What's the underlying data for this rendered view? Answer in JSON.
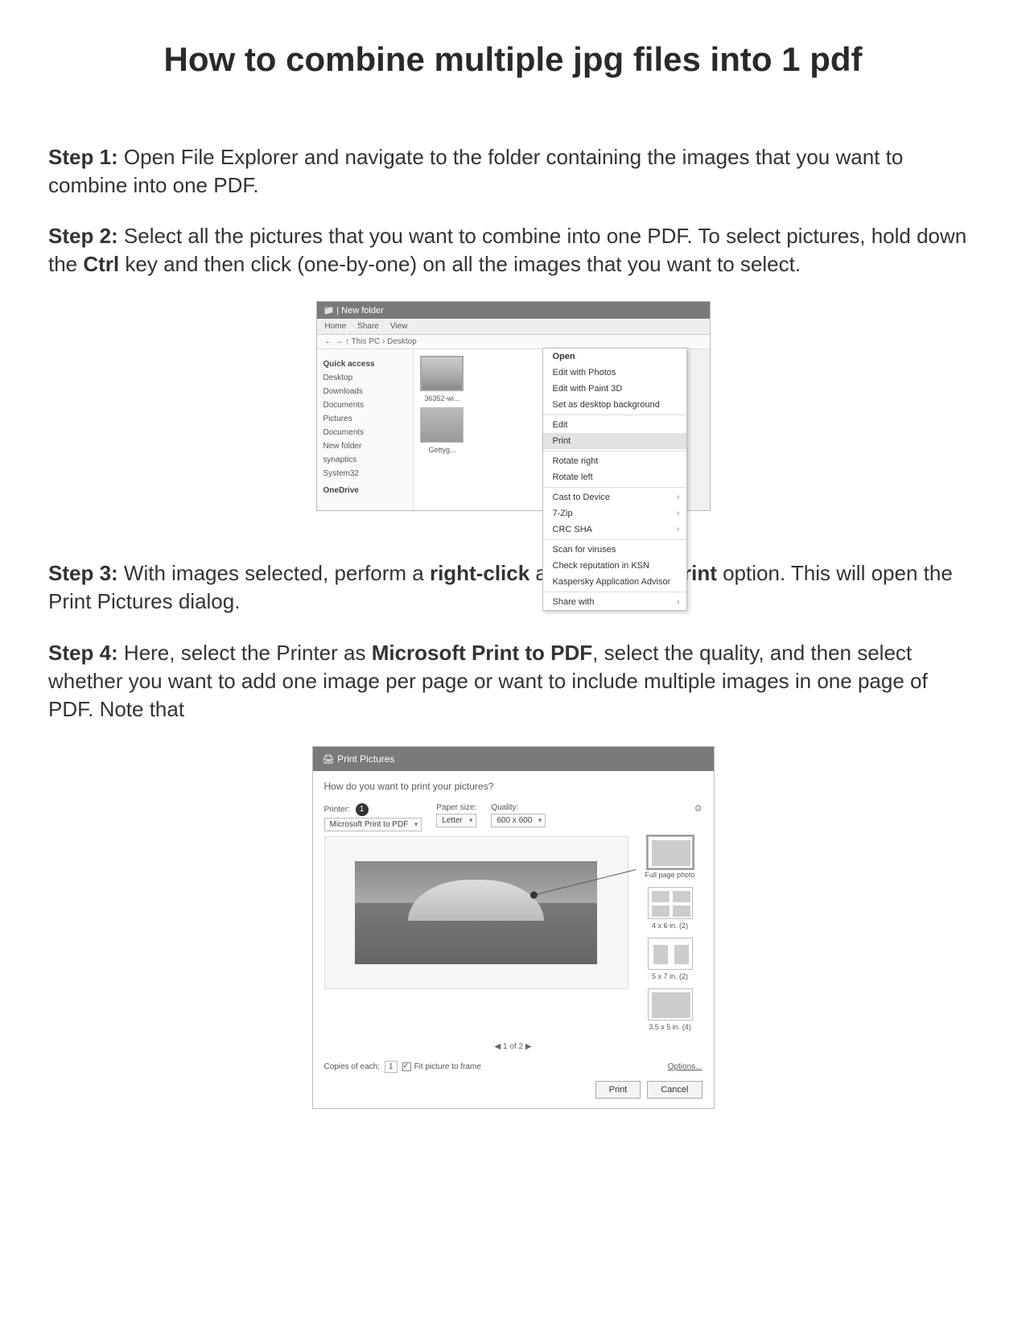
{
  "title": "How to combine multiple jpg files into 1 pdf",
  "steps": {
    "s1": {
      "label": "Step 1:",
      "text": " Open File Explorer and navigate to the folder containing the images that you want to combine into one PDF."
    },
    "s2": {
      "label": "Step 2:",
      "text_a": " Select all the pictures that you want to combine into one PDF. To select pictures, hold down the ",
      "ctrl": "Ctrl",
      "text_b": " key and then click (one-by-one) on all the images that you want to select."
    },
    "s3": {
      "label": "Step 3:",
      "text_a": " With images selected, perform a ",
      "rc": "right-click",
      "text_b": " and then click ",
      "print": "Print",
      "text_c": " option. This will open the Print Pictures dialog."
    },
    "s4": {
      "label": "Step 4:",
      "text_a": " Here, select the Printer as ",
      "mp": "Microsoft Print to PDF",
      "text_b": ", select the quality, and then select whether you want to add one image per page or want to include multiple images in one page of PDF. Note that"
    }
  },
  "explorer": {
    "window_title": "New folder",
    "tabs": [
      "Home",
      "Share",
      "View"
    ],
    "address": "This PC › Desktop",
    "sidebar": {
      "quick": "Quick access",
      "items": [
        "Desktop",
        "Downloads",
        "Documents",
        "Pictures",
        "Documents",
        "New folder",
        "synaptics",
        "System32"
      ],
      "onedrive": "OneDrive"
    },
    "thumbs": [
      "36352-wi...",
      "Gettyg..."
    ],
    "context": {
      "open": "Open",
      "edit_photos": "Edit with Photos",
      "edit_paint3d": "Edit with Paint 3D",
      "set_bg": "Set as desktop background",
      "edit": "Edit",
      "print": "Print",
      "rotr": "Rotate right",
      "rotl": "Rotate left",
      "cast": "Cast to Device",
      "zip": "7-Zip",
      "crc": "CRC SHA",
      "scan": "Scan for viruses",
      "kav1": "Check reputation in KSN",
      "kav2": "Kaspersky Application Advisor",
      "share": "Share with"
    }
  },
  "print": {
    "window_title": "Print Pictures",
    "question": "How do you want to print your pictures?",
    "fields": {
      "printer_lbl": "Printer:",
      "printer_val": "Microsoft Print to PDF",
      "paper_lbl": "Paper size:",
      "paper_val": "Letter",
      "quality_lbl": "Quality:",
      "quality_val": "600 x 600"
    },
    "layouts": {
      "full": "Full page photo",
      "l4x6": "4 x 6 in. (2)",
      "l5x7": "5 x 7 in. (2)",
      "l3x5": "3.5 x 5 in. (4)"
    },
    "pager": "1 of 2",
    "copies_lbl": "Copies of each:",
    "copies_val": "1",
    "fit_lbl": "Fit picture to frame",
    "options": "Options...",
    "btn_print": "Print",
    "btn_cancel": "Cancel"
  }
}
